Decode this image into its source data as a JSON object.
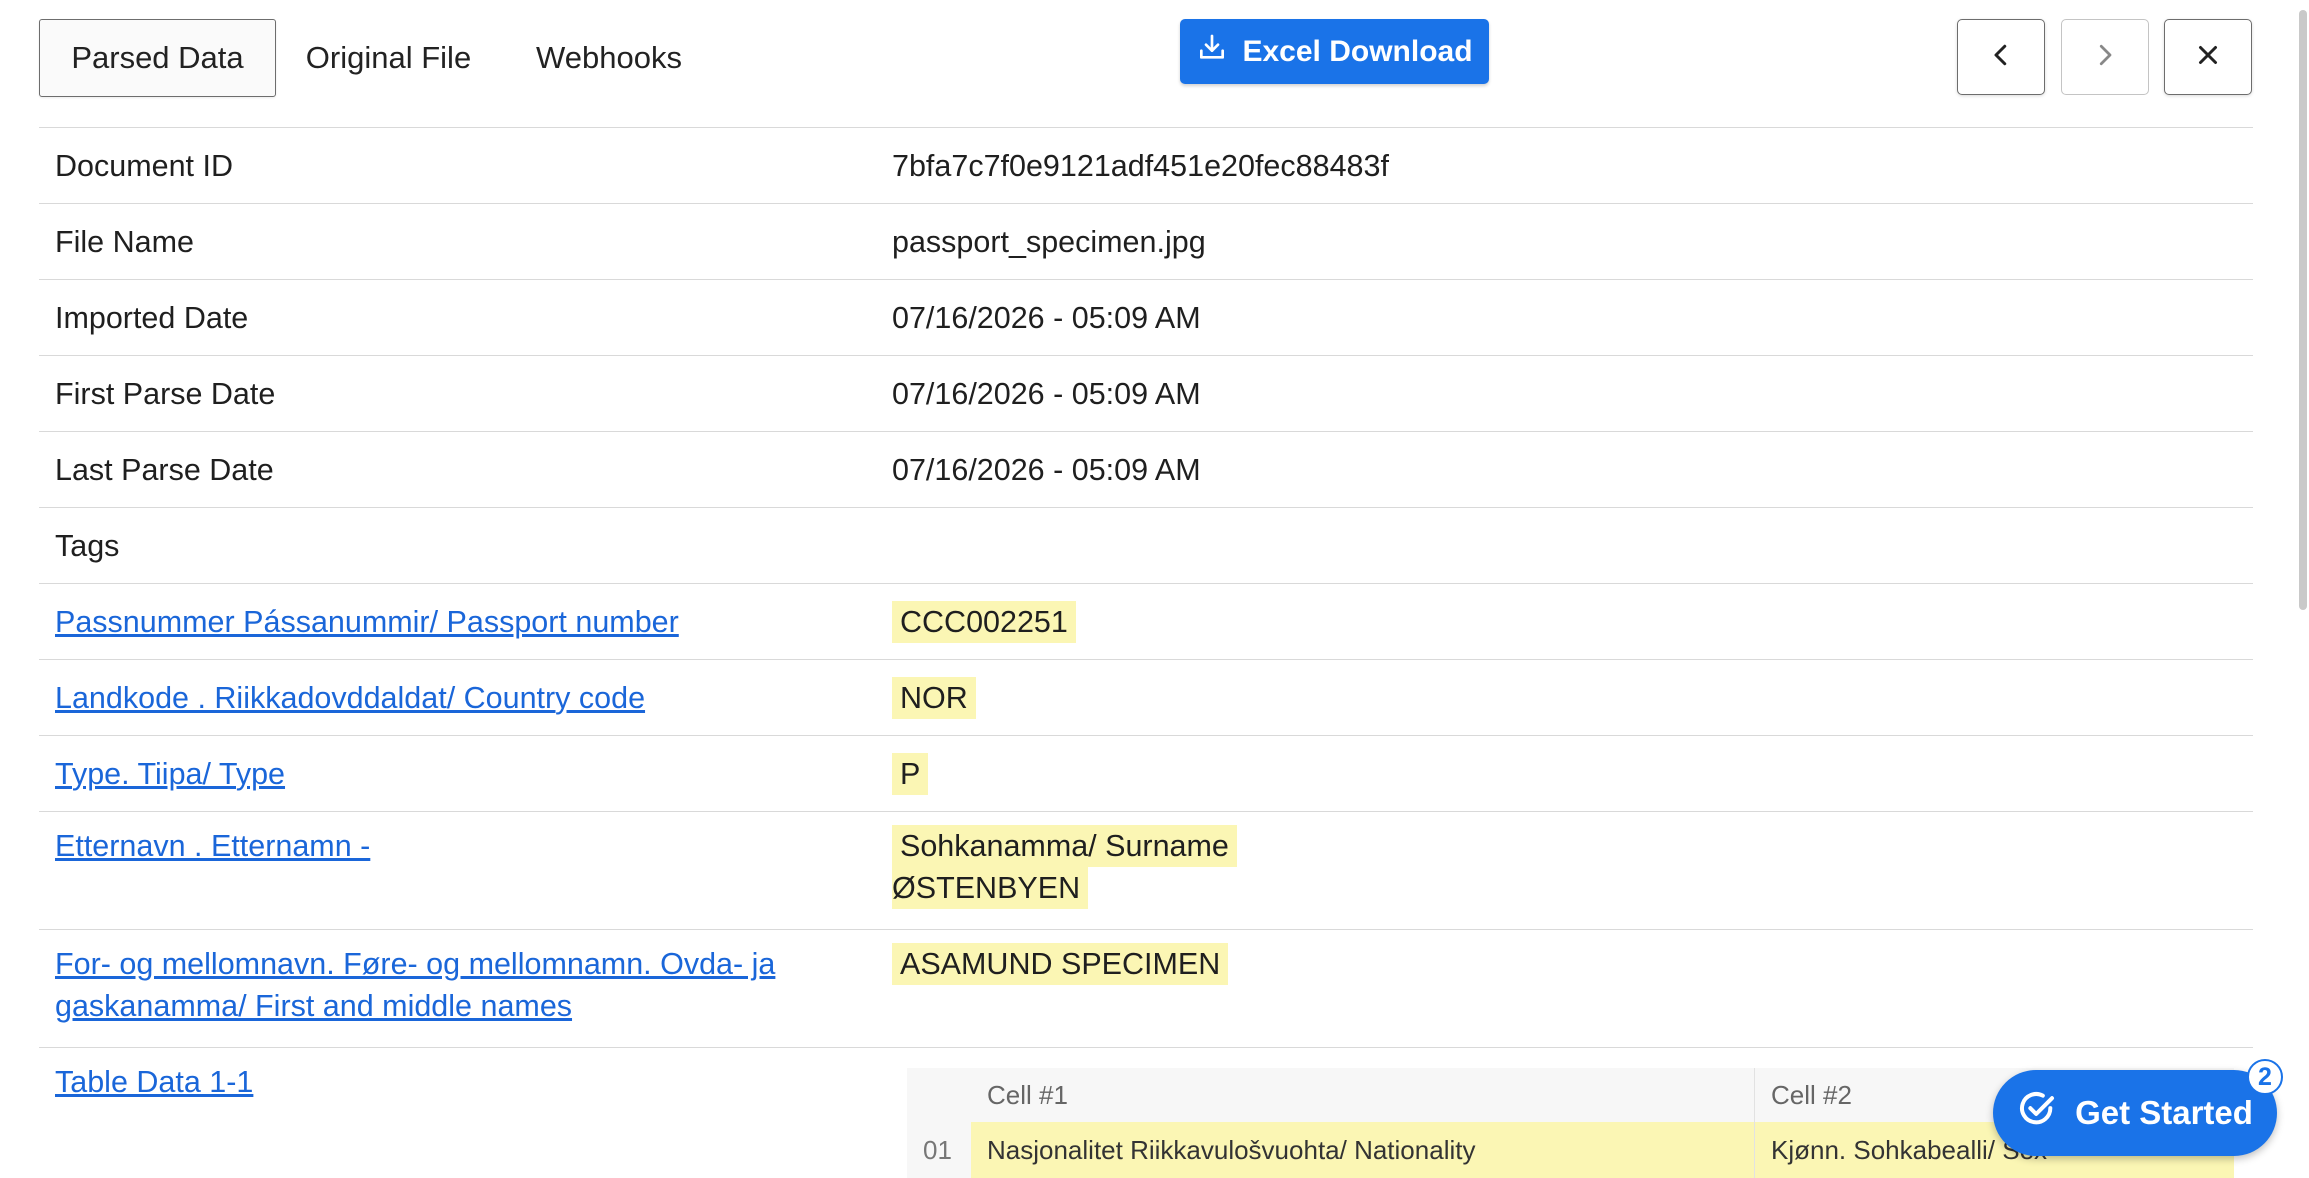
{
  "tabs": {
    "parsed": "Parsed Data",
    "original": "Original File",
    "webhooks": "Webhooks"
  },
  "toolbar": {
    "excel_download": "Excel Download"
  },
  "details": {
    "document_id": {
      "label": "Document ID",
      "value": "7bfa7c7f0e9121adf451e20fec88483f"
    },
    "file_name": {
      "label": "File Name",
      "value": "passport_specimen.jpg"
    },
    "imported_date": {
      "label": "Imported Date",
      "value": "07/16/2026 - 05:09 AM"
    },
    "first_parse": {
      "label": "First Parse Date",
      "value": "07/16/2026 - 05:09 AM"
    },
    "last_parse": {
      "label": "Last Parse Date",
      "value": "07/16/2026 - 05:09 AM"
    },
    "tags": {
      "label": "Tags",
      "value": ""
    }
  },
  "fields": {
    "passport_number": {
      "label": "Passnummer Pássanummir/ Passport number",
      "value": "CCC002251"
    },
    "country_code": {
      "label": "Landkode . Riikkadovddaldat/ Country code",
      "value": "NOR"
    },
    "type": {
      "label": "Type. Tiipa/ Type",
      "value": "P"
    },
    "surname": {
      "label": "Etternavn . Etternamn -",
      "value_line1": "Sohkanamma/ Surname",
      "value_line2": "ØSTENBYEN"
    },
    "given_names": {
      "label_line1": "For- og mellomnavn. Føre- og mellomnamn. Ovda- ja",
      "label_line2": "gaskanamma/ First and middle names",
      "value": "ASAMUND SPECIMEN"
    },
    "table_data": {
      "label": "Table Data 1-1"
    }
  },
  "subtable": {
    "headers": [
      "Cell #1",
      "Cell #2"
    ],
    "rows": [
      {
        "index": "01",
        "cell1": "Nasjonalitet Riikkavulošvuohta/ Nationality",
        "cell2": "Kjønn. Sohkabealli/ Sex"
      }
    ]
  },
  "get_started": {
    "label": "Get Started",
    "badge": "2"
  },
  "colors": {
    "accent": "#1a73e8",
    "highlight": "#fbf6b4",
    "link": "#1a66d9"
  }
}
